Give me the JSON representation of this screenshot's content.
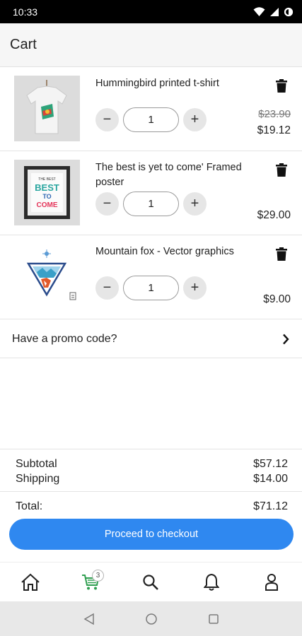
{
  "status_bar": {
    "time": "10:33"
  },
  "header": {
    "title": "Cart"
  },
  "items": [
    {
      "name": "Hummingbird printed t-shirt",
      "quantity": "1",
      "old_price": "$23.90",
      "price": "$19.12"
    },
    {
      "name": "The best is yet to come' Framed poster",
      "quantity": "1",
      "price": "$29.00"
    },
    {
      "name": "Mountain fox - Vector graphics",
      "quantity": "1",
      "price": "$9.00"
    }
  ],
  "poster_text": {
    "top": "THE BEST",
    "middle": "BEST",
    "to": "TO",
    "come": "COME"
  },
  "promo": {
    "label": "Have a promo code?"
  },
  "totals": {
    "subtotal_label": "Subtotal",
    "subtotal": "$57.12",
    "shipping_label": "Shipping",
    "shipping": "$14.00",
    "total_label": "Total:",
    "total": "$71.12"
  },
  "checkout": {
    "label": "Proceed to checkout"
  },
  "nav": {
    "cart_count": "3"
  },
  "icons": {
    "delete": "trash-icon",
    "promo_arrow": "chevron-right-icon",
    "home": "home-icon",
    "cart": "cart-icon",
    "search": "search-icon",
    "notifications": "bell-icon",
    "account": "user-icon"
  },
  "colors": {
    "accent": "#2f88f0",
    "cart_active": "#2e9e4f",
    "status_bar": "#000000"
  }
}
